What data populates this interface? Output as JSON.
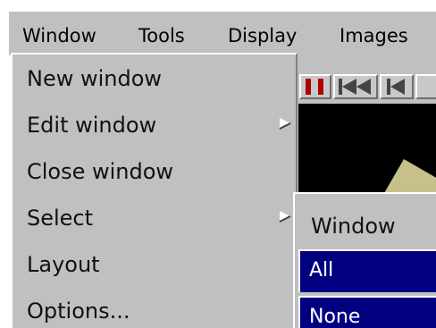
{
  "menubar": {
    "items": [
      {
        "label": "Window"
      },
      {
        "label": "Tools"
      },
      {
        "label": "Display"
      },
      {
        "label": "Images"
      }
    ]
  },
  "window_menu": {
    "items": [
      {
        "label": "New window",
        "has_submenu": false
      },
      {
        "label": "Edit window",
        "has_submenu": true
      },
      {
        "label": "Close window",
        "has_submenu": false
      },
      {
        "label": "Select",
        "has_submenu": true
      },
      {
        "label": "Layout",
        "has_submenu": false
      },
      {
        "label": "Options...",
        "has_submenu": false
      }
    ]
  },
  "select_submenu": {
    "title": "Window",
    "options": [
      {
        "label": "All",
        "selected": true
      },
      {
        "label": "None",
        "selected": true
      }
    ]
  },
  "toolbar": {
    "buttons": [
      {
        "icon": "pause-icon"
      },
      {
        "icon": "skip-to-start-icon"
      },
      {
        "icon": "step-back-icon"
      }
    ]
  },
  "colors": {
    "menu_bg": "#c0c0c0",
    "selection_bg": "#000080",
    "selection_text": "#ffffff",
    "pause_red": "#b00000",
    "viewport_bg": "#000000"
  }
}
